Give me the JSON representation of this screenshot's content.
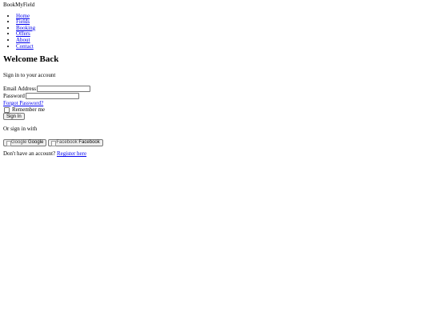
{
  "brand": "BookMyField",
  "nav": {
    "items": [
      {
        "label": "Home"
      },
      {
        "label": "Fields"
      },
      {
        "label": "Booking"
      },
      {
        "label": "Offers"
      },
      {
        "label": "About"
      },
      {
        "label": "Contact"
      }
    ]
  },
  "login": {
    "title": "Welcome Back",
    "subtitle": "Sign in to your account",
    "email_label": "Email Address",
    "email_value": "",
    "password_label": "Password",
    "password_value": "",
    "forgot_label": "Forgot Password?",
    "remember_label": "Remember me",
    "remember_checked": false,
    "signin_label": "Sign In"
  },
  "social": {
    "intro": "Or sign in with",
    "google": {
      "alt": "Google",
      "label": "Google"
    },
    "facebook": {
      "alt": "Facebook",
      "label": "Facebook"
    }
  },
  "register": {
    "prompt": "Don't have an account?",
    "link_label": "Register here"
  }
}
